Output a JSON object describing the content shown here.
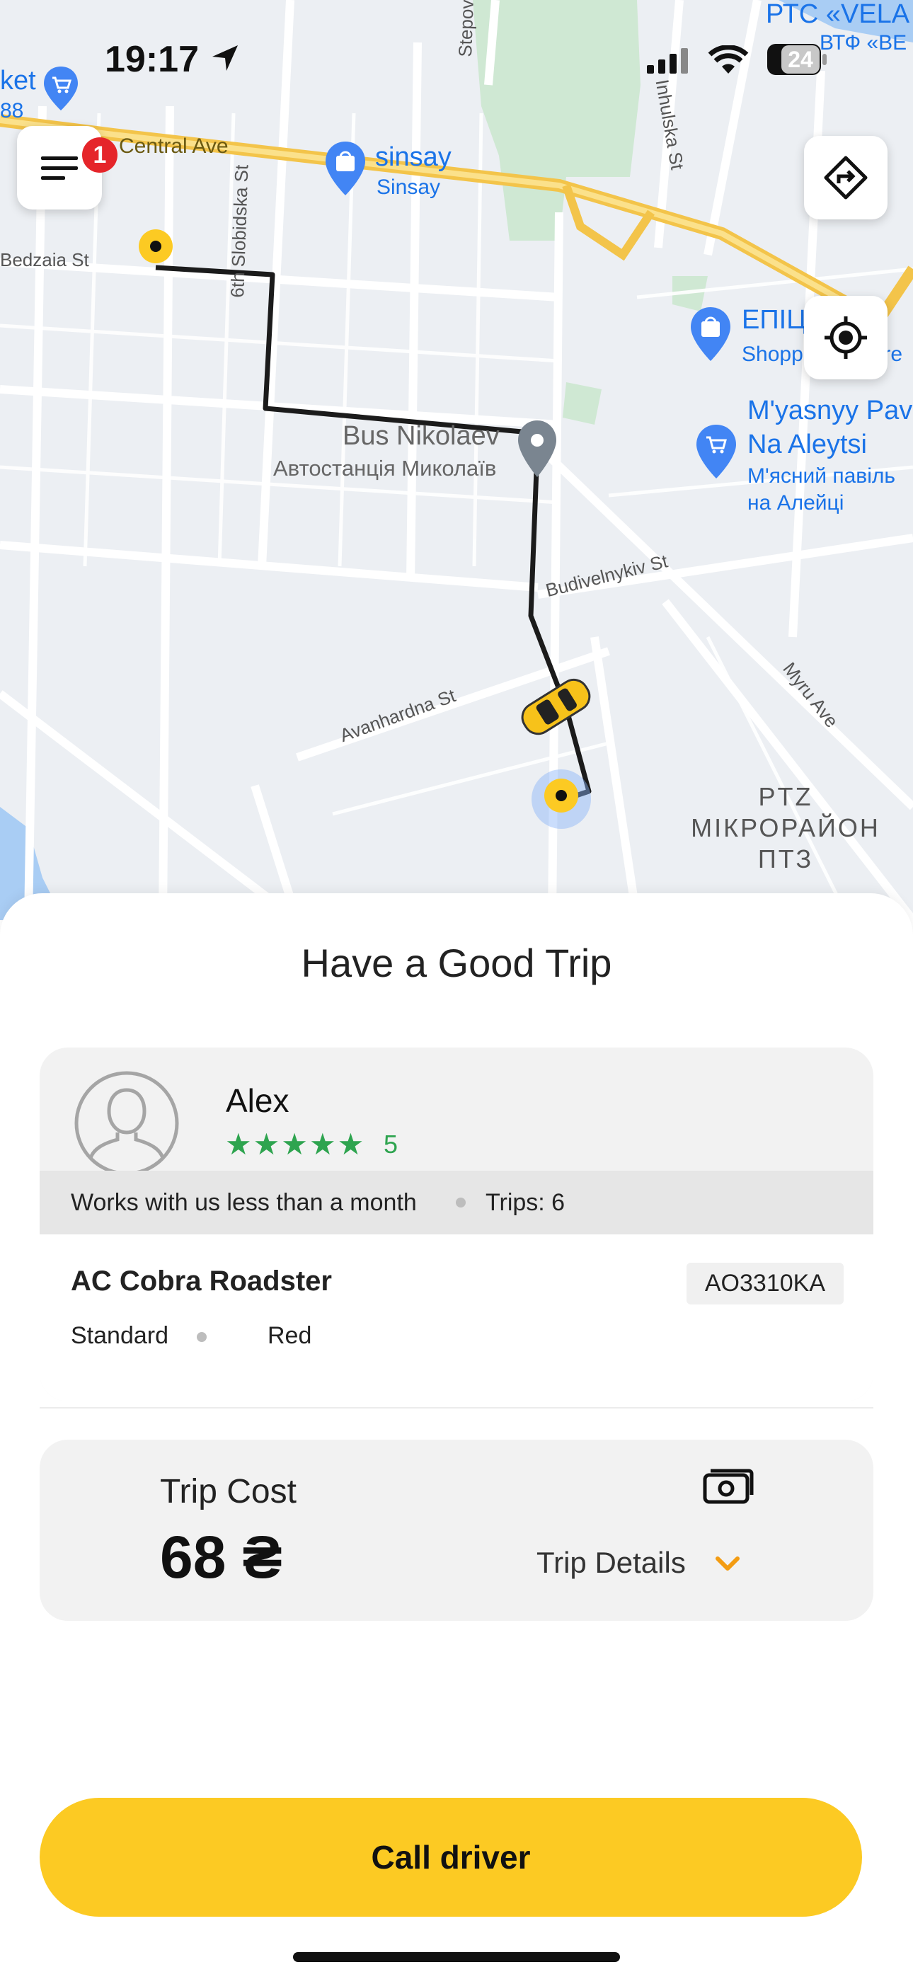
{
  "status_bar": {
    "time": "19:17",
    "battery": "24"
  },
  "map": {
    "streets": {
      "central_ave": "Central Ave",
      "bedzaia": "Bedzaia St",
      "slobidska": "6th Slobidska St",
      "inhulska": "Inhulska St",
      "stepova": "Stepova",
      "budivelnykiv": "Budivelnykiv St",
      "avanhardna": "Avanhardna St",
      "myru": "Myru Ave"
    },
    "places": {
      "sinsay_1": "sinsay",
      "sinsay_2": "Sinsay",
      "market": "ket",
      "market_num": "88",
      "bus_1": "Bus Nikolaev",
      "bus_2": "Автостанція Миколаїв",
      "epil_1": "ЕПІЦ",
      "epil_2": "Shopp",
      "epil_3": "tre",
      "myasnyy_1": "M'yasnyy Pav",
      "myasnyy_2": "Na Aleytsi",
      "myasnyy_3": "М'ясний павіль",
      "myasnyy_4": "на Алейці",
      "rts_1": "РТС «VELA",
      "rts_2": "ВТФ «ВЕ",
      "ptz_1": "PTZ",
      "ptz_2": "МІКРОРАЙОН",
      "ptz_3": "ПТЗ"
    },
    "menu_badge": "1"
  },
  "sheet": {
    "title": "Have a Good Trip",
    "driver": {
      "name": "Alex",
      "stars": "★★★★★",
      "rating": "5",
      "tenure": "Works with us less than a month",
      "trips": "Trips: 6"
    },
    "car": {
      "model": "AC Cobra Roadster",
      "plate": "AO3310KA",
      "class": "Standard",
      "color": "Red"
    },
    "cost": {
      "label": "Trip Cost",
      "value": "68 ₴",
      "details_label": "Trip Details"
    },
    "call_button": "Call driver"
  },
  "colors": {
    "accent_yellow": "#fcca23",
    "rating_green": "#2ea44f",
    "badge_red": "#e5252a",
    "chevron_orange": "#f39c12"
  }
}
